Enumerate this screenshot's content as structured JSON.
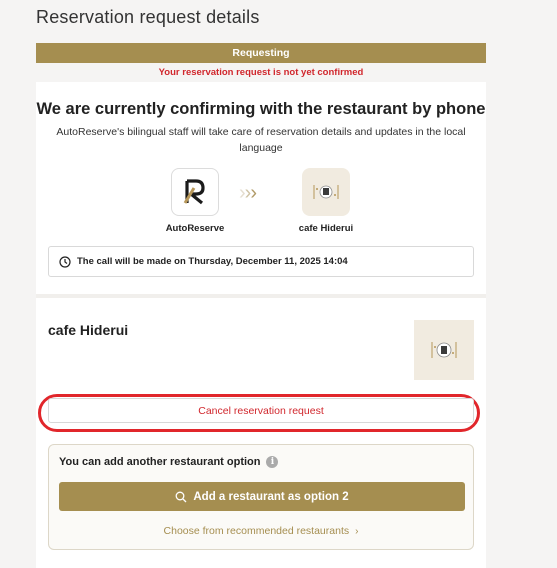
{
  "page": {
    "title": "Reservation request details"
  },
  "status": {
    "label": "Requesting",
    "warning": "Your reservation request is not yet confirmed",
    "accent_color": "#a58e50",
    "warning_color": "#d1272d"
  },
  "confirm": {
    "heading": "We are currently confirming with the restaurant by phone",
    "description": "AutoReserve's bilingual staff will take care of reservation details and updates in the local language",
    "from_label": "AutoReserve",
    "to_label": "cafe Hiderui",
    "call_info": "The call will be made on Thursday, December 11, 2025 14:04"
  },
  "icons": {
    "autoreserve": "autoreserve-logo",
    "cafe": "cafe-hiderui-logo",
    "clock": "clock-icon",
    "info": "info-icon",
    "search": "search-icon",
    "chevron": "chevron-right-icon"
  },
  "restaurant": {
    "name": "cafe Hiderui",
    "cancel_label": "Cancel reservation request"
  },
  "options": {
    "title": "You can add another restaurant option",
    "add_label": "Add a restaurant as option 2",
    "recommend_label": "Choose from recommended restaurants"
  }
}
